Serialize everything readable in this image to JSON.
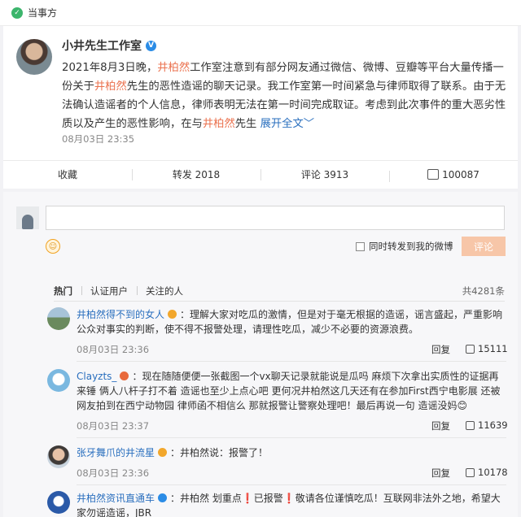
{
  "topbar": {
    "label": "当事方"
  },
  "post": {
    "author": "小井先生工作室",
    "text_1": "2021年8月3日晚，",
    "hl_1": "井柏然",
    "text_2": "工作室注意到有部分网友通过微信、微博、豆瓣等平台大量传播一份关于",
    "hl_2": "井柏然",
    "text_3": "先生的恶性造谣的聊天记录。我工作室第一时间紧急与律师取得了联系。由于无法确认造谣者的个人信息，律师表明无法在第一时间完成取证。考虑到此次事件的重大恶劣性质以及产生的恶性影响，在与",
    "hl_3": "井柏然",
    "text_4": "先生",
    "more": "展开全文",
    "time": "08月03日 23:35"
  },
  "actions": {
    "collect": "收藏",
    "repost": "转发 2018",
    "comment": "评论 3913",
    "like": "100087"
  },
  "composer": {
    "repost_option": "同时转发到我的微博",
    "submit": "评论"
  },
  "tabs": [
    "热门",
    "认证用户",
    "关注的人"
  ],
  "total": "共4281条",
  "comments": [
    {
      "name": "井柏然得不到的女人",
      "text": "：理解大家对吃瓜的激情，但是对于毫无根据的造谣，谣言盛起，严重影响公众对事实的判断，使不得不报警处理，请理性吃瓜，减少不必要的资源浪费。",
      "time": "08月03日 23:36",
      "reply": "回复",
      "likes": "15111"
    },
    {
      "name": "Clayzts_",
      "text": "：现在随随便便一张截图一个vx聊天记录就能说是瓜吗 麻烦下次拿出实质性的证据再来锤 俩人八杆子打不着 造谣也至少上点心吧 更何况井柏然这几天还有在参加First西宁电影展 还被网友拍到在西宁动物园 律师函不相信么 那就报警让警察处理吧！最后再说一句 造谣没妈😊",
      "time": "08月03日 23:37",
      "reply": "回复",
      "likes": "11639"
    },
    {
      "name": "张牙舞爪的井流星",
      "text": "：井柏然说：报警了！",
      "time": "08月03日 23:36",
      "reply": "回复",
      "likes": "10178"
    },
    {
      "name": "井柏然资讯直通车",
      "text": "：井柏然 划重点❗已报警❗敬请各位谨慎吃瓜！互联网非法外之地，希望大家勿谣造谣，JBR",
      "time": "",
      "reply": "",
      "likes": ""
    }
  ]
}
